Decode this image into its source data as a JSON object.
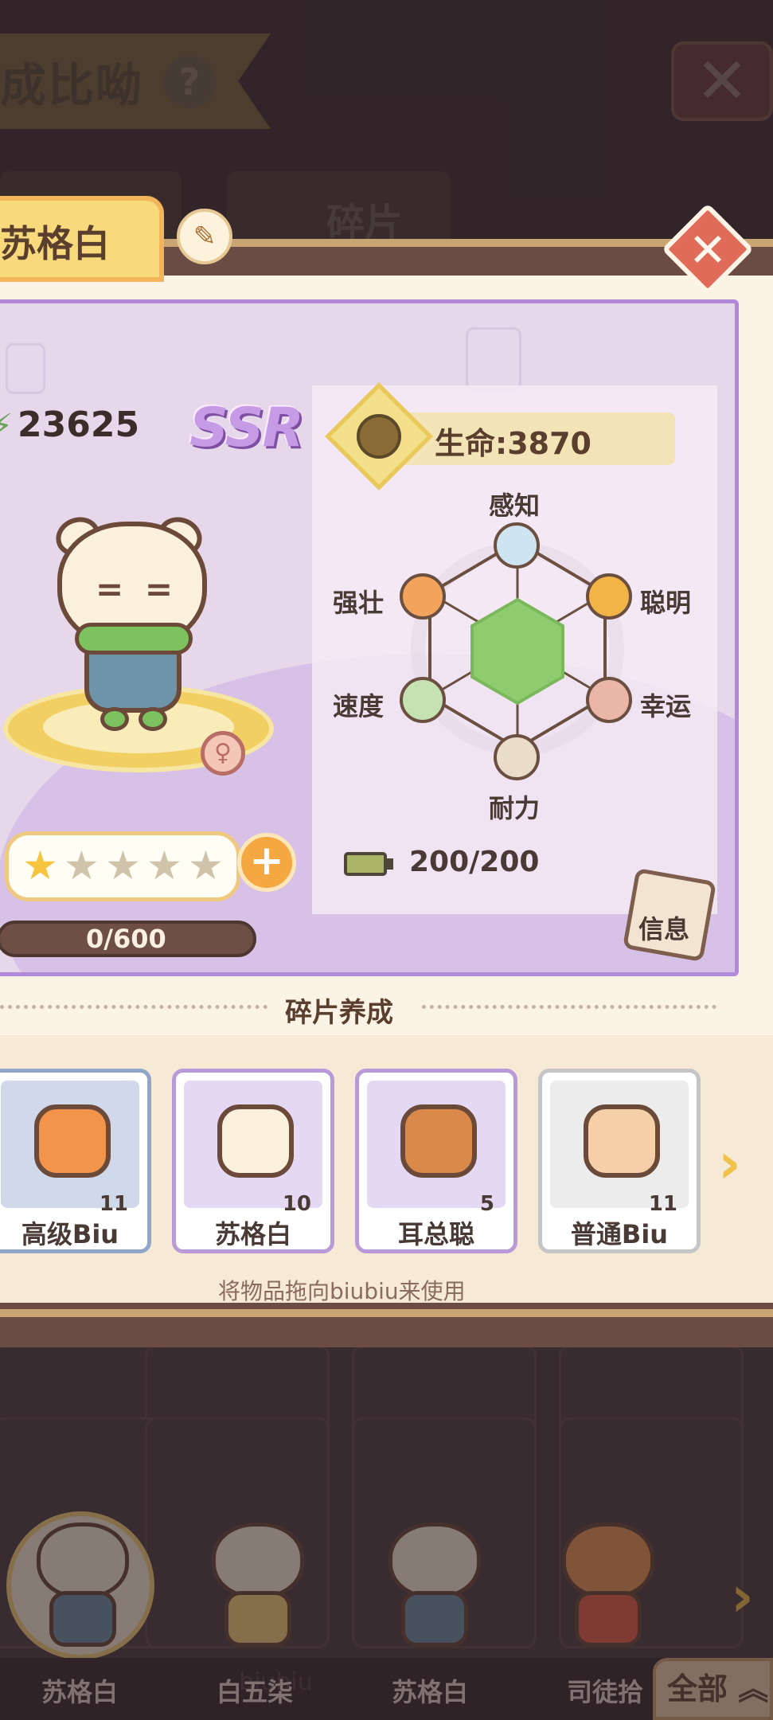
{
  "background": {
    "title": "成比呦",
    "help_icon": "?",
    "fragments_tab": "碎片",
    "all_button": "全部",
    "watermark": "biubiu",
    "bottom_characters": [
      "苏格白",
      "白五柒",
      "苏格白",
      "司徒拾"
    ]
  },
  "card": {
    "name": "苏格白",
    "rarity": "SSR",
    "power": "23625",
    "hp_label": "生命:3870",
    "attributes": {
      "perception": "感知",
      "smart": "聪明",
      "lucky": "幸运",
      "endurance": "耐力",
      "speed": "速度",
      "strong": "强壮"
    },
    "stamina": "200/200",
    "info_button": "信息",
    "stars_filled": 1,
    "stars_total": 5,
    "xp": "0/600",
    "colors": {
      "accent": "#b289d9",
      "gold": "#f3b55c",
      "hexagon": "#8fcc6f"
    }
  },
  "fragments": {
    "title": "碎片养成",
    "items": [
      {
        "name": "高级Biu",
        "count": "11"
      },
      {
        "name": "苏格白",
        "count": "10"
      },
      {
        "name": "耳总聪",
        "count": "5"
      },
      {
        "name": "普通Biu",
        "count": "11"
      }
    ],
    "hint": "将物品拖向biubiu来使用"
  }
}
